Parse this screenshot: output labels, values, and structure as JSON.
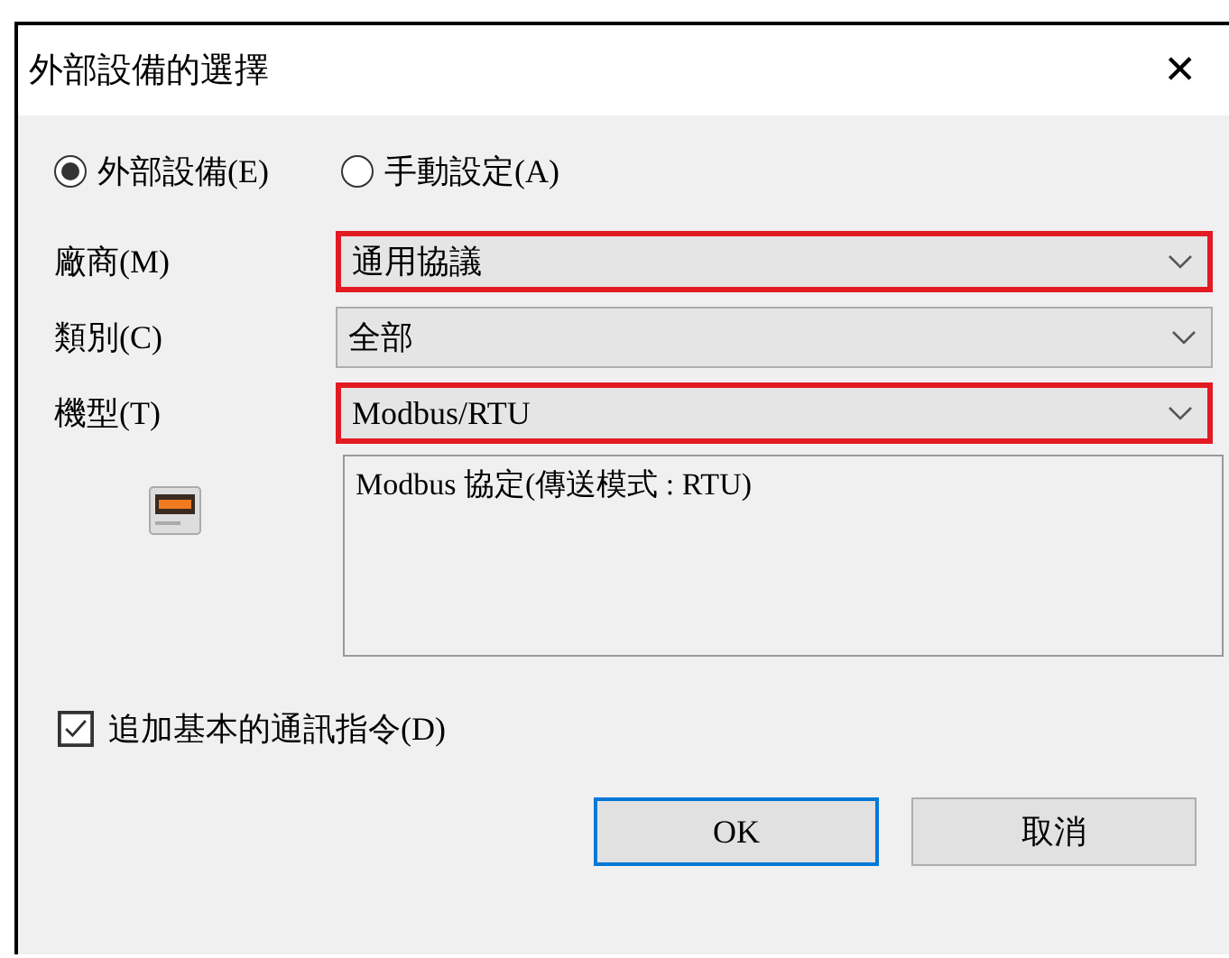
{
  "window": {
    "title": "外部設備的選擇",
    "close": "✕"
  },
  "mode_options": [
    {
      "label": "外部設備(E)",
      "selected": true
    },
    {
      "label": "手動設定(A)",
      "selected": false
    }
  ],
  "fields": [
    {
      "label": "廠商(M)",
      "value": "通用協議",
      "highlighted": true
    },
    {
      "label": "類別(C)",
      "value": "全部",
      "highlighted": false
    },
    {
      "label": "機型(T)",
      "value": "Modbus/RTU",
      "highlighted": true
    }
  ],
  "description": "Modbus 協定(傳送模式 : RTU)",
  "option": {
    "label": "追加基本的通訊指令(D)",
    "checked": true
  },
  "buttons": [
    {
      "label": "OK",
      "kind": "default"
    },
    {
      "label": "取消",
      "kind": "normal"
    }
  ]
}
